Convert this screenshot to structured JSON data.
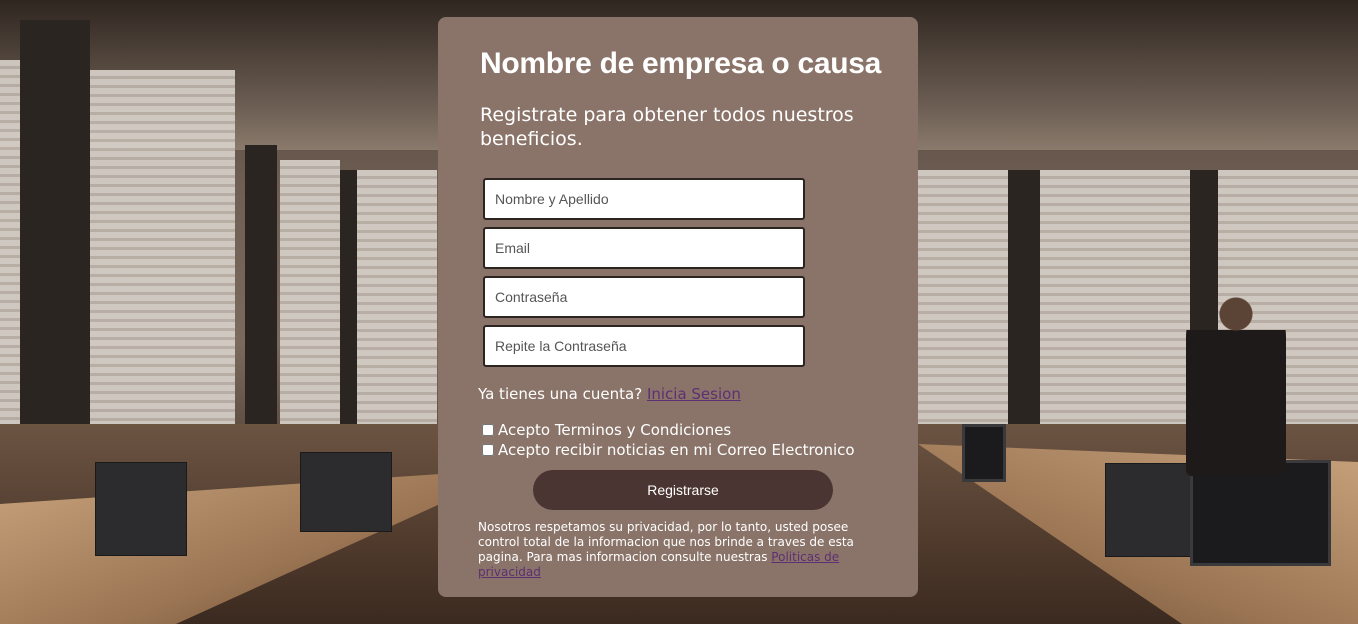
{
  "form": {
    "title": "Nombre de empresa o causa",
    "subtitle": "Registrate para obtener todos nuestros beneficios.",
    "fields": [
      {
        "placeholder": "Nombre y Apellido",
        "value": ""
      },
      {
        "placeholder": "Email",
        "value": ""
      },
      {
        "placeholder": "Contraseña",
        "value": ""
      },
      {
        "placeholder": "Repite la Contraseña",
        "value": ""
      }
    ],
    "login_prompt": "Ya tienes una cuenta?",
    "login_link": "Inicia Sesion",
    "checkboxes": [
      {
        "label": "Acepto Terminos y Condiciones",
        "checked": false
      },
      {
        "label": "Acepto recibir noticias en mi Correo Electronico",
        "checked": false
      }
    ],
    "submit_label": "Registrarse",
    "privacy_text": "Nosotros respetamos su privacidad, por lo tanto, usted posee control total de la informacion que nos brinde a traves de esta pagina. Para mas informacion consulte nuestras",
    "privacy_link": "Politicas de privacidad"
  },
  "colors": {
    "card_bg": "#8a7469",
    "button_bg": "#4b3532",
    "link": "#5d2f73",
    "text": "#ffffff"
  }
}
